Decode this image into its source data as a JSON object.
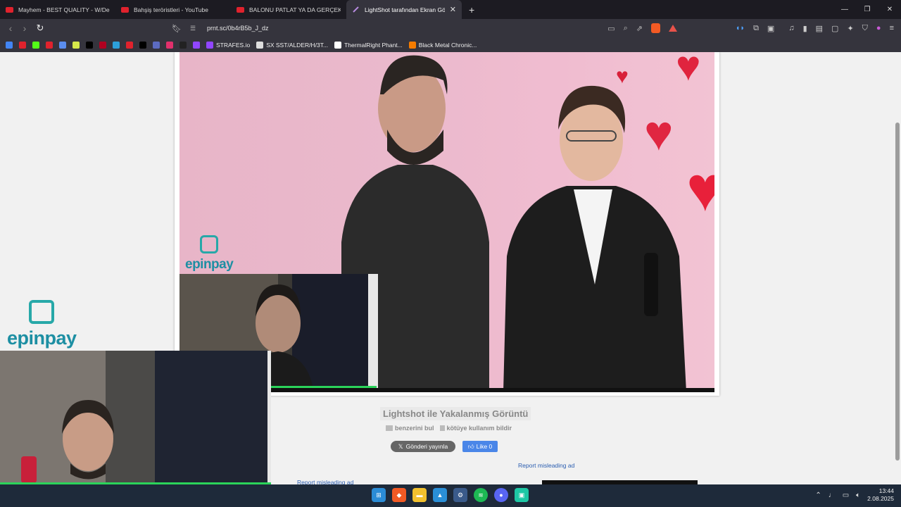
{
  "tabs": [
    {
      "title": "Mayhem - BEST QUALITY - W/Dead /",
      "favicon": "youtube-icon",
      "active": false
    },
    {
      "title": "Bahşiş teröristleri - YouTube",
      "favicon": "youtube-icon",
      "active": false
    },
    {
      "title": "BALONU PATLAT YA DA GERÇEK AŞK",
      "favicon": "youtube-icon",
      "active": false
    },
    {
      "title": "LightShot tarafından Ekran Görü",
      "favicon": "lightshot-icon",
      "active": true
    }
  ],
  "new_tab": "+",
  "window_controls": {
    "minimize": "—",
    "restore": "❐",
    "close": "✕"
  },
  "url": "prnt.sc/0b4rB5b_J_dz",
  "bookmarks": [
    {
      "label": "",
      "color": "#4285f4"
    },
    {
      "label": "",
      "color": "#e0222d"
    },
    {
      "label": "",
      "color": "#53fc18"
    },
    {
      "label": "",
      "color": "#e0222d"
    },
    {
      "label": "",
      "color": "#5b8def"
    },
    {
      "label": "",
      "color": "#d6e84a"
    },
    {
      "label": "",
      "color": "#000000"
    },
    {
      "label": "",
      "color": "#b00020"
    },
    {
      "label": "",
      "color": "#2c9fd9"
    },
    {
      "label": "",
      "color": "#e0222d"
    },
    {
      "label": "",
      "color": "#000000"
    },
    {
      "label": "",
      "color": "#5c6bc0"
    },
    {
      "label": "",
      "color": "#e1306c"
    },
    {
      "label": "",
      "color": "#222222"
    },
    {
      "label": "",
      "color": "#9146ff"
    },
    {
      "label": "STRAFES.io",
      "color": "#9146ff"
    },
    {
      "label": "SX SST/ALDER/H/3T...",
      "color": "#dddddd"
    },
    {
      "label": "ThermalRight Phant...",
      "color": "#ffffff"
    },
    {
      "label": "Black Metal Chronic...",
      "color": "#f57c00"
    }
  ],
  "page": {
    "caption": "Lightshot ile Yakalanmış Görüntü",
    "similar": "benzerini bul",
    "report_abuse": "kötüye kullanım bildir",
    "tweet": "Gönderi yayınla",
    "like": "Like 0",
    "report_ad_1": "Report misleading ad",
    "report_ad_2": "Report misleading ad"
  },
  "overlay": {
    "brand_small": "epinpay",
    "brand_large": "epinpay"
  },
  "taskbar": {
    "time": "13:44",
    "date": "2.08.2025"
  },
  "colors": {
    "accent": "#27a8a8",
    "link": "#2a5db0"
  }
}
